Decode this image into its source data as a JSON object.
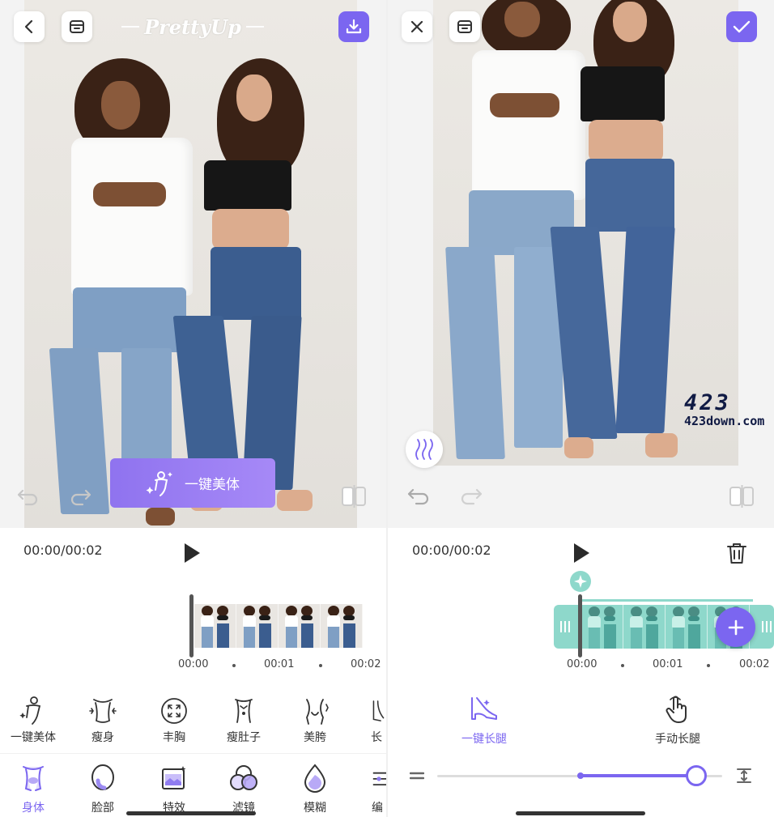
{
  "left_screen": {
    "brand": "PrettyUp",
    "top_buttons": {
      "back_icon": "chevron-left-icon",
      "compare_icon": "archive-icon",
      "download_icon": "download-icon"
    },
    "one_key_button": "一键美体",
    "time_display": "00:00/00:02",
    "timeline_ticks": [
      "00:00",
      "00:01",
      "00:02"
    ],
    "tools": [
      {
        "label": "一键美体",
        "icon": "auto-body-icon"
      },
      {
        "label": "瘦身",
        "icon": "slim-icon"
      },
      {
        "label": "丰胸",
        "icon": "chest-icon"
      },
      {
        "label": "瘦肚子",
        "icon": "belly-icon"
      },
      {
        "label": "美胯",
        "icon": "hip-icon"
      },
      {
        "label": "长",
        "icon": "leg-icon"
      }
    ],
    "bottom_nav": [
      {
        "label": "身体",
        "icon": "body-icon",
        "active": true
      },
      {
        "label": "脸部",
        "icon": "face-icon",
        "active": false
      },
      {
        "label": "特效",
        "icon": "effects-icon",
        "active": false
      },
      {
        "label": "滤镜",
        "icon": "filter-icon",
        "active": false
      },
      {
        "label": "模糊",
        "icon": "blur-icon",
        "active": false
      },
      {
        "label": "编",
        "icon": "edit-icon",
        "active": false
      }
    ]
  },
  "right_screen": {
    "top_buttons": {
      "close_icon": "close-icon",
      "compare_icon": "archive-icon",
      "confirm_icon": "check-icon"
    },
    "watermark": {
      "big": "423",
      "small": "423down.com"
    },
    "time_display": "00:00/00:02",
    "timeline_ticks": [
      "00:00",
      "00:01",
      "00:02"
    ],
    "options": [
      {
        "label": "一键长腿",
        "icon": "high-heel-icon",
        "active": true
      },
      {
        "label": "手动长腿",
        "icon": "hand-pointer-icon",
        "active": false
      }
    ],
    "slider_value": 0.91
  },
  "colors": {
    "accent": "#7b66f0",
    "teal": "#8ed8cb"
  }
}
